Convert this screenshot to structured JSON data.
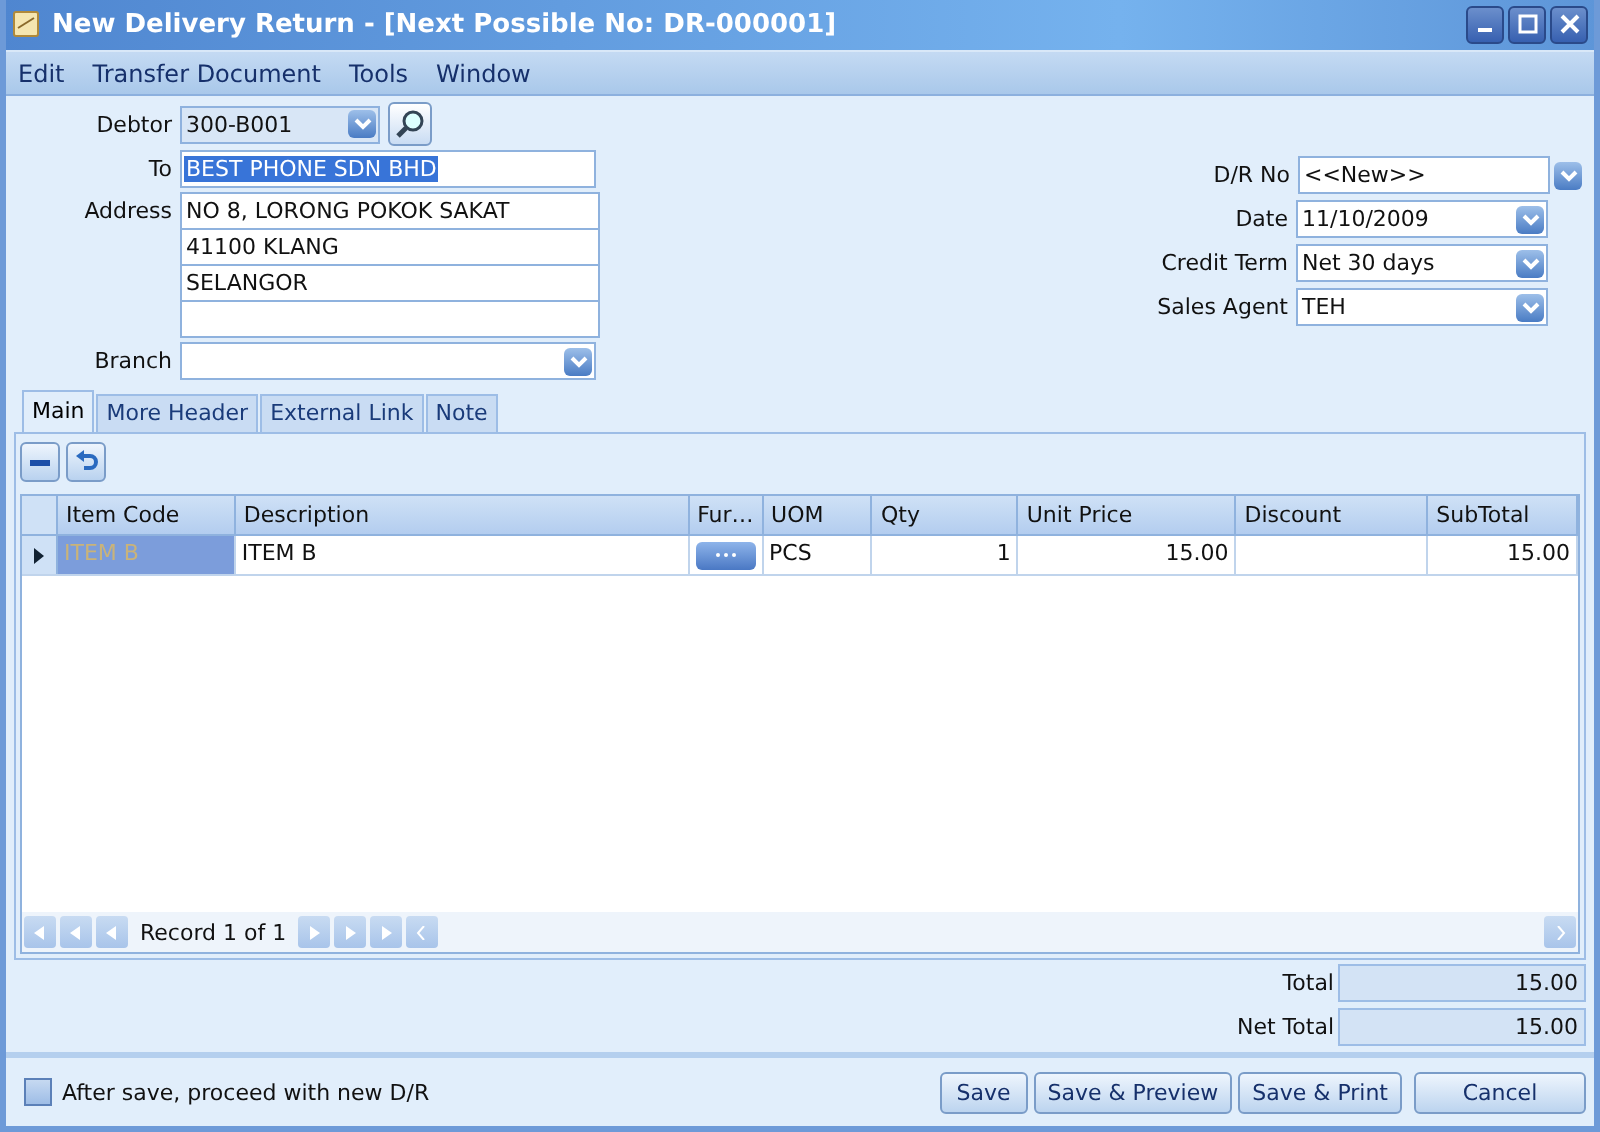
{
  "window": {
    "title": "New Delivery Return - [Next Possible No: DR-000001]"
  },
  "menu": [
    "Edit",
    "Transfer Document",
    "Tools",
    "Window"
  ],
  "debtor": {
    "label": "Debtor",
    "value": "300-B001"
  },
  "to": {
    "label": "To",
    "value": "BEST PHONE SDN BHD",
    "text_selected": true
  },
  "address": {
    "label": "Address",
    "lines": [
      "NO 8, LORONG POKOK SAKAT",
      "41100 KLANG",
      "SELANGOR"
    ]
  },
  "branch": {
    "label": "Branch"
  },
  "right_fields": [
    {
      "label": "D/R No",
      "value": "<<New>>",
      "kind": "combo-wide"
    },
    {
      "label": "Date",
      "value": "11/10/2009",
      "kind": "combo"
    },
    {
      "label": "Credit Term",
      "value": "Net 30 days",
      "kind": "combo"
    },
    {
      "label": "Sales Agent",
      "value": "TEH",
      "kind": "combo"
    }
  ],
  "tabs": [
    {
      "label": "Main",
      "selected": true
    },
    {
      "label": "More Header",
      "selected": false
    },
    {
      "label": "External Link",
      "selected": false
    },
    {
      "label": "Note",
      "selected": false
    }
  ],
  "table": {
    "columns": [
      "Item Code",
      "Description",
      "Fur…",
      "UOM",
      "Qty",
      "Unit Price",
      "Discount",
      "SubTotal"
    ],
    "rows": [
      {
        "selected": true,
        "cells": [
          "ITEM B",
          "ITEM B",
          "",
          "PCS",
          "1",
          "15.00",
          "",
          "15.00"
        ]
      }
    ]
  },
  "navigator": {
    "text": "Record 1 of 1"
  },
  "totals": [
    {
      "label": "Total",
      "value": "15.00"
    },
    {
      "label": "Net Total",
      "value": "15.00"
    }
  ],
  "proceed_checkbox": {
    "label": "After save, proceed with new D/R",
    "checked": false
  },
  "buttons": [
    "Save",
    "Save & Preview",
    "Save & Print",
    "Cancel"
  ]
}
